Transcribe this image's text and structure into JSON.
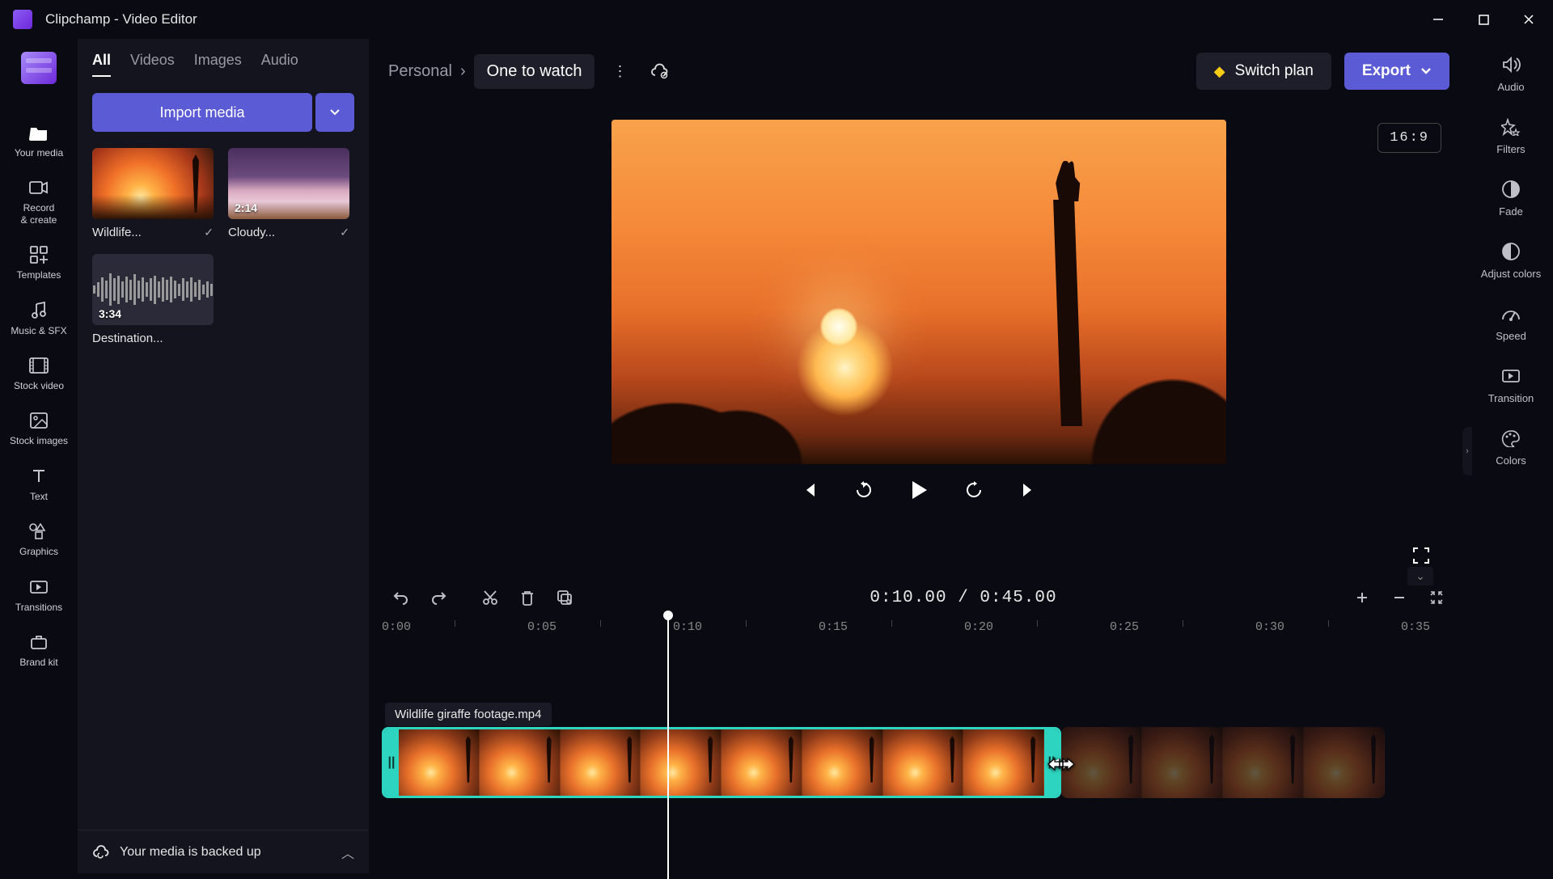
{
  "titlebar": {
    "title": "Clipchamp - Video Editor"
  },
  "leftnav": {
    "items": [
      {
        "label": "Your media"
      },
      {
        "label": "Record\n& create"
      },
      {
        "label": "Templates"
      },
      {
        "label": "Music & SFX"
      },
      {
        "label": "Stock video"
      },
      {
        "label": "Stock images"
      },
      {
        "label": "Text"
      },
      {
        "label": "Graphics"
      },
      {
        "label": "Transitions"
      },
      {
        "label": "Brand kit"
      }
    ]
  },
  "media_panel": {
    "tabs": [
      "All",
      "Videos",
      "Images",
      "Audio"
    ],
    "import_label": "Import media",
    "items": [
      {
        "name": "Wildlife...",
        "duration": ""
      },
      {
        "name": "Cloudy...",
        "duration": "2:14"
      },
      {
        "name": "Destination...",
        "duration": "3:34"
      }
    ],
    "backup_text": "Your media is backed up"
  },
  "topbar": {
    "breadcrumb_root": "Personal",
    "breadcrumb_current": "One to watch",
    "switch_plan": "Switch plan",
    "export": "Export"
  },
  "preview": {
    "aspect": "16:9"
  },
  "timeline": {
    "time_display": "0:10.00 / 0:45.00",
    "ticks": [
      "0:00",
      "0:05",
      "0:10",
      "0:15",
      "0:20",
      "0:25",
      "0:30",
      "0:35"
    ],
    "clip_label": "Wildlife giraffe footage.mp4"
  },
  "rightpanel": {
    "items": [
      {
        "label": "Audio"
      },
      {
        "label": "Filters"
      },
      {
        "label": "Fade"
      },
      {
        "label": "Adjust colors"
      },
      {
        "label": "Speed"
      },
      {
        "label": "Transition"
      },
      {
        "label": "Colors"
      }
    ]
  }
}
